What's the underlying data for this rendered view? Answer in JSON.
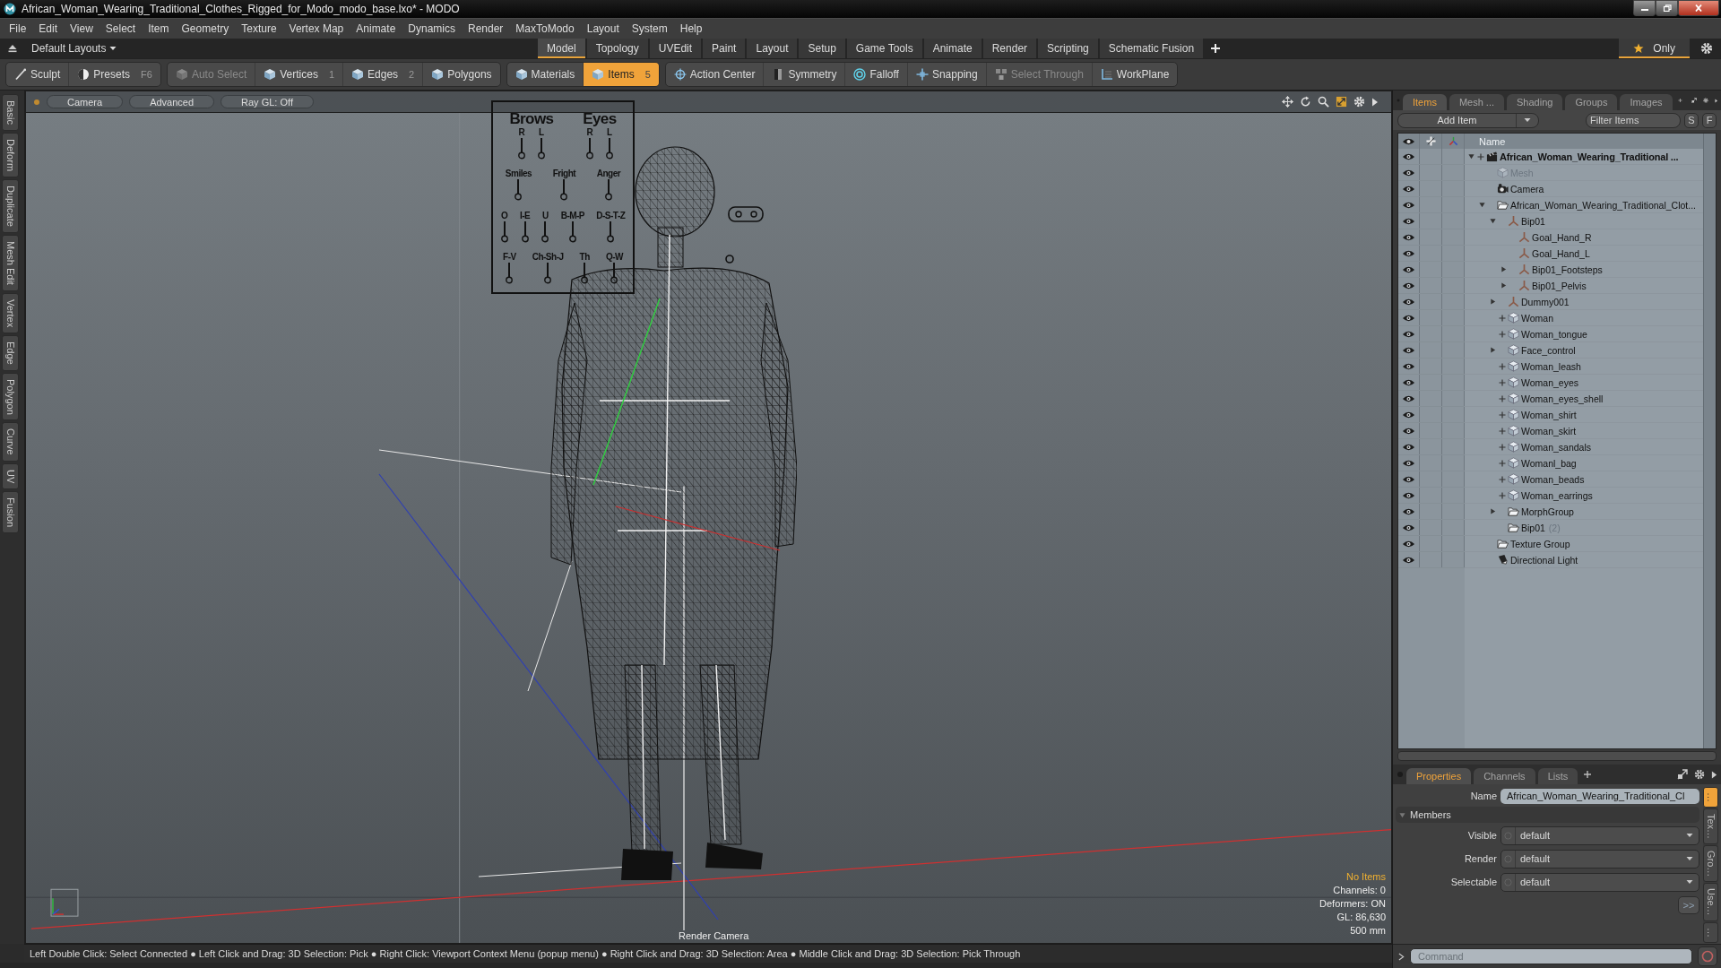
{
  "window": {
    "title": "African_Woman_Wearing_Traditional_Clothes_Rigged_for_Modo_modo_base.lxo* - MODO"
  },
  "menu": [
    "File",
    "Edit",
    "View",
    "Select",
    "Item",
    "Geometry",
    "Texture",
    "Vertex Map",
    "Animate",
    "Dynamics",
    "Render",
    "MaxToModo",
    "Layout",
    "System",
    "Help"
  ],
  "layouts": {
    "label": "Default Layouts",
    "tabs": [
      {
        "label": "Model",
        "selected": true
      },
      {
        "label": "Topology",
        "selected": false
      },
      {
        "label": "UVEdit",
        "selected": false
      },
      {
        "label": "Paint",
        "selected": false
      },
      {
        "label": "Layout",
        "selected": false
      },
      {
        "label": "Setup",
        "selected": false
      },
      {
        "label": "Game Tools",
        "selected": false
      },
      {
        "label": "Animate",
        "selected": false
      },
      {
        "label": "Render",
        "selected": false
      },
      {
        "label": "Scripting",
        "selected": false
      },
      {
        "label": "Schematic Fusion",
        "selected": false
      }
    ],
    "only": {
      "label": "Only",
      "on": true
    }
  },
  "toolbar": {
    "groups": [
      [
        {
          "label": "Sculpt",
          "kind": "brush",
          "selected": false,
          "disabled": false
        },
        {
          "label": "Presets",
          "shortcut": "F6",
          "kind": "presets",
          "selected": false,
          "disabled": false
        }
      ],
      [
        {
          "label": "Auto Select",
          "kind": "cube",
          "selected": false,
          "disabled": true
        },
        {
          "label": "Vertices",
          "shortcut": "1",
          "kind": "cube",
          "selected": false,
          "disabled": false
        },
        {
          "label": "Edges",
          "shortcut": "2",
          "kind": "cube",
          "selected": false,
          "disabled": false
        },
        {
          "label": "Polygons",
          "kind": "cube",
          "selected": false,
          "disabled": false
        }
      ],
      [
        {
          "label": "Materials",
          "kind": "cube",
          "selected": false,
          "disabled": false
        },
        {
          "label": "Items",
          "shortcut": "5",
          "kind": "cube",
          "selected": true,
          "disabled": false
        }
      ],
      [
        {
          "label": "Action Center",
          "kind": "target",
          "selected": false,
          "disabled": false
        },
        {
          "label": "Symmetry",
          "kind": "symmetry",
          "selected": false,
          "disabled": false
        },
        {
          "label": "Falloff",
          "kind": "falloff",
          "selected": false,
          "disabled": false
        },
        {
          "label": "Snapping",
          "kind": "snap",
          "selected": false,
          "disabled": false
        },
        {
          "label": "Select Through",
          "kind": "through",
          "selected": false,
          "disabled": true
        },
        {
          "label": "WorkPlane",
          "kind": "workplane",
          "selected": false,
          "disabled": false
        }
      ]
    ]
  },
  "tool_tabs": [
    "Basic",
    "Deform",
    "Duplicate",
    "Mesh Edit",
    "Vertex",
    "Edge",
    "Polygon",
    "Curve",
    "UV",
    "Fusion"
  ],
  "viewport": {
    "buttons": [
      "Camera",
      "Advanced",
      "Ray GL: Off"
    ],
    "face_board": {
      "groups": [
        {
          "label": "Brows",
          "subs": [
            "R",
            "L"
          ]
        },
        {
          "label": "Eyes",
          "subs": [
            "R",
            "L"
          ]
        }
      ],
      "expressions": [
        "Smiles",
        "Fright",
        "Anger"
      ],
      "mouth_shapes": [
        "O",
        "I-E",
        "U",
        "B-M-P",
        "D-S-T-Z",
        "F-V",
        "Ch-Sh-J",
        "Th",
        "Q-W"
      ]
    },
    "info": [
      {
        "text": "No Items",
        "highlight": true
      },
      {
        "text": "Channels: 0",
        "highlight": false
      },
      {
        "text": "Deformers: ON",
        "highlight": false
      },
      {
        "text": "GL: 86,630",
        "highlight": false
      },
      {
        "text": "500 mm",
        "highlight": false
      }
    ],
    "camera_label": "Render Camera"
  },
  "status_bar": {
    "hints": "Left Double Click: Select Connected ● Left Click and Drag: 3D Selection: Pick ● Right Click: Viewport Context Menu (popup menu) ● Right Click and Drag: 3D Selection: Area ● Middle Click and Drag: 3D Selection: Pick Through"
  },
  "items_panel": {
    "tabs": [
      {
        "label": "Items",
        "selected": true
      },
      {
        "label": "Mesh ...",
        "selected": false
      },
      {
        "label": "Shading",
        "selected": false
      },
      {
        "label": "Groups",
        "selected": false
      },
      {
        "label": "Images",
        "selected": false
      }
    ],
    "add_button": "Add Item",
    "filter": {
      "placeholder": "Filter Items"
    },
    "filter_buttons": [
      "S",
      "F"
    ],
    "name_column": "Name",
    "tree": [
      {
        "name": "African_Woman_Wearing_Traditional ...",
        "kind": "scene",
        "visible": true,
        "selected": false,
        "plus": true,
        "dimmed": false,
        "expanded": true,
        "children": [
          {
            "name": "Mesh",
            "kind": "mesh",
            "visible": true,
            "selected": false,
            "plus": false,
            "dimmed": true
          },
          {
            "name": "Camera",
            "kind": "camera",
            "visible": true,
            "selected": false,
            "plus": false,
            "dimmed": false
          },
          {
            "name": "African_Woman_Wearing_Traditional_Clot...",
            "kind": "group",
            "visible": true,
            "selected": false,
            "plus": false,
            "dimmed": false,
            "expanded": true,
            "children": [
              {
                "name": "Bip01",
                "kind": "locator",
                "visible": true,
                "selected": false,
                "plus": false,
                "dimmed": false,
                "expanded": true,
                "children": [
                  {
                    "name": "Goal_Hand_R",
                    "kind": "locator",
                    "visible": true,
                    "selected": false,
                    "plus": false,
                    "dimmed": false
                  },
                  {
                    "name": "Goal_Hand_L",
                    "kind": "locator",
                    "visible": true,
                    "selected": false,
                    "plus": false,
                    "dimmed": false
                  },
                  {
                    "name": "Bip01_Footsteps",
                    "kind": "locator",
                    "visible": true,
                    "selected": false,
                    "plus": false,
                    "dimmed": false,
                    "expanded": false
                  },
                  {
                    "name": "Bip01_Pelvis",
                    "kind": "locator",
                    "visible": true,
                    "selected": false,
                    "plus": false,
                    "dimmed": false,
                    "expanded": false
                  }
                ]
              },
              {
                "name": "Dummy001",
                "kind": "locator",
                "visible": true,
                "selected": false,
                "plus": false,
                "dimmed": false,
                "expanded": false
              },
              {
                "name": "Woman",
                "kind": "mesh",
                "visible": true,
                "selected": false,
                "plus": true,
                "dimmed": false
              },
              {
                "name": "Woman_tongue",
                "kind": "mesh",
                "visible": true,
                "selected": false,
                "plus": true,
                "dimmed": false
              },
              {
                "name": "Face_control",
                "kind": "mesh",
                "visible": true,
                "selected": false,
                "plus": false,
                "dimmed": false,
                "expanded": false
              },
              {
                "name": "Woman_leash",
                "kind": "mesh",
                "visible": true,
                "selected": false,
                "plus": true,
                "dimmed": false
              },
              {
                "name": "Woman_eyes",
                "kind": "mesh",
                "visible": true,
                "selected": false,
                "plus": true,
                "dimmed": false
              },
              {
                "name": "Woman_eyes_shell",
                "kind": "mesh",
                "visible": true,
                "selected": false,
                "plus": true,
                "dimmed": false
              },
              {
                "name": "Woman_shirt",
                "kind": "mesh",
                "visible": true,
                "selected": false,
                "plus": true,
                "dimmed": false
              },
              {
                "name": "Woman_skirt",
                "kind": "mesh",
                "visible": true,
                "selected": false,
                "plus": true,
                "dimmed": false
              },
              {
                "name": "Woman_sandals",
                "kind": "mesh",
                "visible": true,
                "selected": false,
                "plus": true,
                "dimmed": false
              },
              {
                "name": "Womanl_bag",
                "kind": "mesh",
                "visible": true,
                "selected": false,
                "plus": true,
                "dimmed": false
              },
              {
                "name": "Woman_beads",
                "kind": "mesh",
                "visible": true,
                "selected": false,
                "plus": true,
                "dimmed": false
              },
              {
                "name": "Woman_earrings",
                "kind": "mesh",
                "visible": true,
                "selected": false,
                "plus": true,
                "dimmed": false
              },
              {
                "name": "MorphGroup",
                "kind": "group",
                "visible": true,
                "selected": false,
                "plus": false,
                "dimmed": false,
                "expanded": false
              },
              {
                "name": "Bip01",
                "suffix": "(2)",
                "kind": "group",
                "visible": true,
                "selected": false,
                "plus": false,
                "dimmed": false
              }
            ]
          },
          {
            "name": "Texture Group",
            "kind": "group",
            "visible": true,
            "selected": false,
            "plus": false,
            "dimmed": false
          },
          {
            "name": "Directional Light",
            "kind": "light",
            "visible": true,
            "selected": false,
            "plus": false,
            "dimmed": false
          }
        ]
      }
    ]
  },
  "properties": {
    "tabs": [
      {
        "label": "Properties",
        "selected": true
      },
      {
        "label": "Channels",
        "selected": false
      },
      {
        "label": "Lists",
        "selected": false
      }
    ],
    "name": {
      "label": "Name",
      "value": "African_Woman_Wearing_Traditional_Cl"
    },
    "section": {
      "label": "Members",
      "expanded": true
    },
    "fields": [
      {
        "label": "Visible",
        "value": "default"
      },
      {
        "label": "Render",
        "value": "default"
      },
      {
        "label": "Selectable",
        "value": "default"
      }
    ],
    "more_button": ">>",
    "side_tabs": [
      {
        "label": "…",
        "selected": true
      },
      {
        "label": "Tex…",
        "selected": false
      },
      {
        "label": "Gro…",
        "selected": false
      },
      {
        "label": "Use…",
        "selected": false
      },
      {
        "label": "…",
        "selected": false
      }
    ]
  },
  "command": {
    "placeholder": "Command"
  }
}
